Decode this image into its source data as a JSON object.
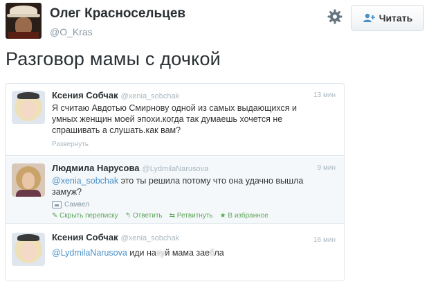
{
  "author": {
    "name": "Олег Красносельцев",
    "handle": "@O_Kras"
  },
  "follow_button": {
    "label": "Читать"
  },
  "tweet_text": "Разговор мамы с дочкой",
  "embedded": [
    {
      "name": "Ксения Собчак",
      "handle": "@xenia_sobchak",
      "time": "13 мин",
      "lines": [
        "Я считаю Авдотью Смирнову одной из самых выдающихся и",
        "умных женщин моей эпохи.когда так думаешь хочется не",
        "спрашивать а слушать.как вам?"
      ],
      "expand_label": "Развернуть"
    },
    {
      "name": "Людмила Нарусова",
      "handle": "@LydmilaNarusova",
      "time": "9 мин",
      "mention": "@xenia_sobchak",
      "line1_rest": " это ты решила потому что она удачно вышла",
      "line2": "замуж?",
      "media_label": "Самвел",
      "actions": [
        "Скрыть переписку",
        "Ответить",
        "Ретвитнуть",
        "В избранное"
      ]
    },
    {
      "name": "Ксения Собчак",
      "handle": "@xenia_sobchak",
      "time": "16 мин",
      "mention": "@LydmilaNarusova",
      "text_a": "  иди на",
      "text_blur1": "ху",
      "text_b": "й мама зае",
      "text_blur2": "б",
      "text_c": "ла"
    }
  ],
  "colors": {
    "link": "#4a90c8",
    "action_green": "#5ba55a",
    "muted": "#aab8c2"
  }
}
